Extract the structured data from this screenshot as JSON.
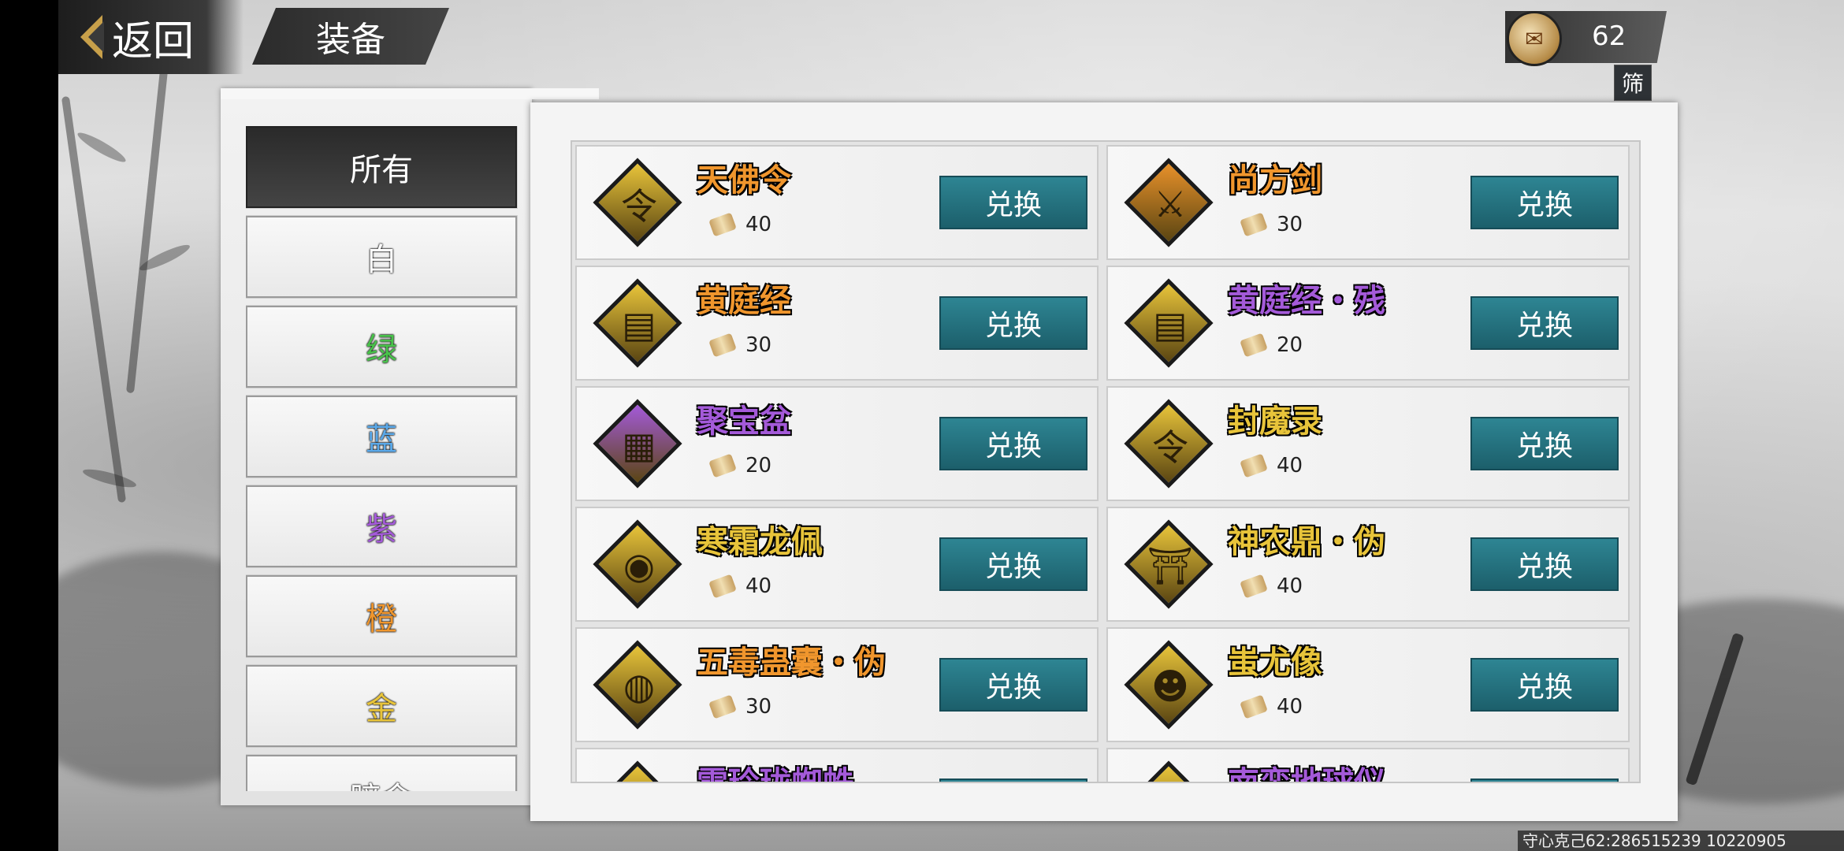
{
  "header": {
    "back_label": "返回",
    "title": "装备",
    "currency_value": "62",
    "filter_label": "筛"
  },
  "colors": {
    "white": "#ffffff",
    "green": "#49c24b",
    "blue": "#5aa8e8",
    "purple": "#a45ad9",
    "orange": "#f0962d",
    "gold": "#e8c43a",
    "accent_button": "#25707d"
  },
  "categories": [
    {
      "label": "所有",
      "color": "#ffffff",
      "active": true
    },
    {
      "label": "白",
      "color": "#ffffff",
      "active": false
    },
    {
      "label": "绿",
      "color": "#49c24b",
      "active": false
    },
    {
      "label": "蓝",
      "color": "#5aa8e8",
      "active": false
    },
    {
      "label": "紫",
      "color": "#a45ad9",
      "active": false
    },
    {
      "label": "橙",
      "color": "#f0962d",
      "active": false
    },
    {
      "label": "金",
      "color": "#e8c43a",
      "active": false
    },
    {
      "label": "暗金",
      "color": "#ffffff",
      "active": false
    }
  ],
  "items": [
    {
      "name": "天佛令",
      "price": "40",
      "color": "#f0962d",
      "frame": "#e8c43a",
      "icon": "token-icon"
    },
    {
      "name": "尚方剑",
      "price": "30",
      "color": "#f0962d",
      "frame": "#e8912a",
      "icon": "sword-icon"
    },
    {
      "name": "黄庭经",
      "price": "30",
      "color": "#f0962d",
      "frame": "#e8c43a",
      "icon": "scripture-icon"
    },
    {
      "name": "黄庭经・残",
      "price": "20",
      "color": "#a45ad9",
      "frame": "#e8c43a",
      "icon": "scripture-icon"
    },
    {
      "name": "聚宝盆",
      "price": "20",
      "color": "#a45ad9",
      "frame": "#a45ad9",
      "icon": "cabinet-icon"
    },
    {
      "name": "封魔录",
      "price": "40",
      "color": "#e8c43a",
      "frame": "#e8c43a",
      "icon": "token-icon"
    },
    {
      "name": "寒霜龙佩",
      "price": "40",
      "color": "#e8c43a",
      "frame": "#e8c43a",
      "icon": "jade-pendant-icon"
    },
    {
      "name": "神农鼎・伪",
      "price": "40",
      "color": "#e8c43a",
      "frame": "#e8c43a",
      "icon": "cauldron-icon"
    },
    {
      "name": "五毒蛊囊・伪",
      "price": "30",
      "color": "#f0962d",
      "frame": "#e8c43a",
      "icon": "pouch-icon"
    },
    {
      "name": "蚩尤像",
      "price": "40",
      "color": "#e8c43a",
      "frame": "#e8c43a",
      "icon": "demon-statue-icon"
    },
    {
      "name": "雪玲珑蜘蛛",
      "price": "",
      "color": "#a45ad9",
      "frame": "#e8c43a",
      "icon": "spider-icon"
    },
    {
      "name": "南蛮地球仪",
      "price": "",
      "color": "#a45ad9",
      "frame": "#e8c43a",
      "icon": "globe-icon"
    }
  ],
  "exchange_label": "兑换",
  "footer": "守心克己62:286515239 10220905"
}
